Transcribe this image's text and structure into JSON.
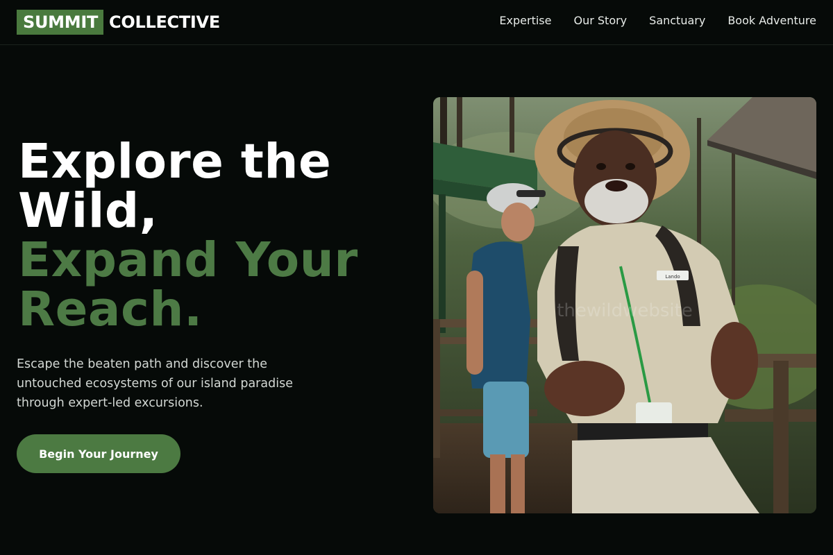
{
  "header": {
    "logo_box": "SUMMIT",
    "logo_rest": "COLLECTIVE",
    "nav": [
      "Expertise",
      "Our Story",
      "Sanctuary",
      "Book Adventure"
    ]
  },
  "hero": {
    "title_line1": "Explore the",
    "title_line2": "Wild,",
    "title_accent1": "Expand Your",
    "title_accent2": "Reach.",
    "subtitle": "Escape the beaten path and discover the untouched ecosystems of our island paradise through expert-led excursions.",
    "cta": "Begin Your Journey"
  },
  "photo": {
    "watermark": "thewildwebsite",
    "name_badge": "Lando"
  },
  "colors": {
    "background": "#060a08",
    "accent": "#4d7a45",
    "text": "#ffffff"
  }
}
